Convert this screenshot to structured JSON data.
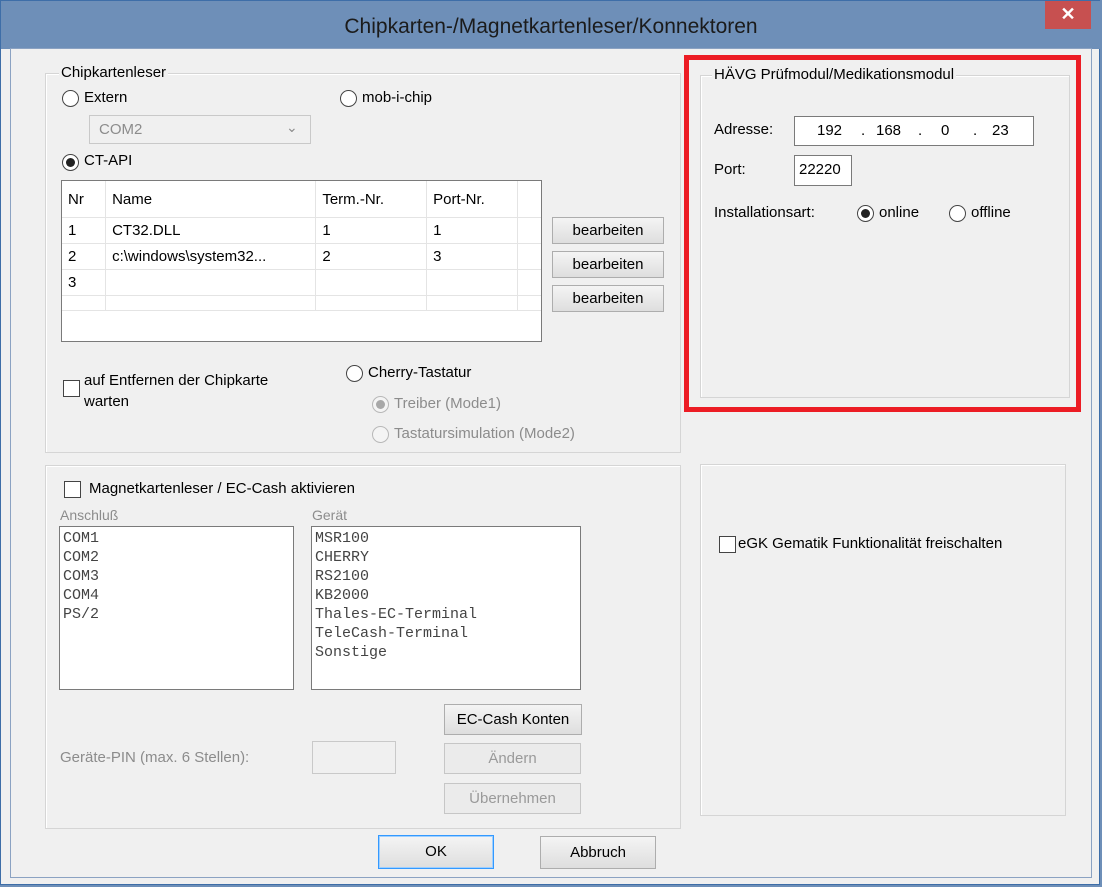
{
  "window": {
    "title": "Chipkarten-/Magnetkartenleser/Konnektoren",
    "close_glyph": "✕"
  },
  "chipkartenleser": {
    "legend": "Chipkartenleser",
    "extern_label": "Extern",
    "mobichip_label": "mob-i-chip",
    "com_value": "COM2",
    "ctapi_label": "CT-API",
    "table": {
      "headers": [
        "Nr",
        "Name",
        "Term.-Nr.",
        "Port-Nr."
      ],
      "rows": [
        [
          "1",
          "CT32.DLL",
          "1",
          "1"
        ],
        [
          "2",
          "c:\\windows\\system32...",
          "2",
          "3"
        ],
        [
          "3",
          "",
          "",
          ""
        ]
      ]
    },
    "edit_label": "bearbeiten",
    "wait_remove_line1": "auf Entfernen der Chipkarte",
    "wait_remove_line2": "warten",
    "cherry_label": "Cherry-Tastatur",
    "treiber_label": "Treiber (Mode1)",
    "tastatursim_label": "Tastatursimulation (Mode2)"
  },
  "haevg": {
    "legend": "HÄVG Prüfmodul/Medikationsmodul",
    "address_label": "Adresse:",
    "ip": [
      "192",
      "168",
      "0",
      "23"
    ],
    "ip_dot": ".",
    "port_label": "Port:",
    "port_value": "22220",
    "install_label": "Installationsart:",
    "online_label": "online",
    "offline_label": "offline"
  },
  "magnet": {
    "enable_label": "Magnetkartenleser / EC-Cash aktivieren",
    "anschluss_label": "Anschluß",
    "anschluss_items": [
      "COM1",
      "COM2",
      "COM3",
      "COM4",
      "PS/2"
    ],
    "geraet_label": "Gerät",
    "geraet_items": [
      "MSR100",
      "CHERRY",
      "RS2100",
      "KB2000",
      "Thales-EC-Terminal",
      "TeleCash-Terminal",
      "Sonstige"
    ],
    "pin_label": "Geräte-PIN (max. 6 Stellen):",
    "eccash_label": "EC-Cash Konten",
    "aendern_label": "Ändern",
    "uebernehmen_label": "Übernehmen"
  },
  "egk": {
    "label": "eGK Gematik Funktionalität freischalten"
  },
  "footer": {
    "ok_label": "OK",
    "cancel_label": "Abbruch"
  },
  "colors": {
    "highlight": "#ec1c24",
    "titlebar": "#6e8fb8",
    "close": "#c75050"
  }
}
